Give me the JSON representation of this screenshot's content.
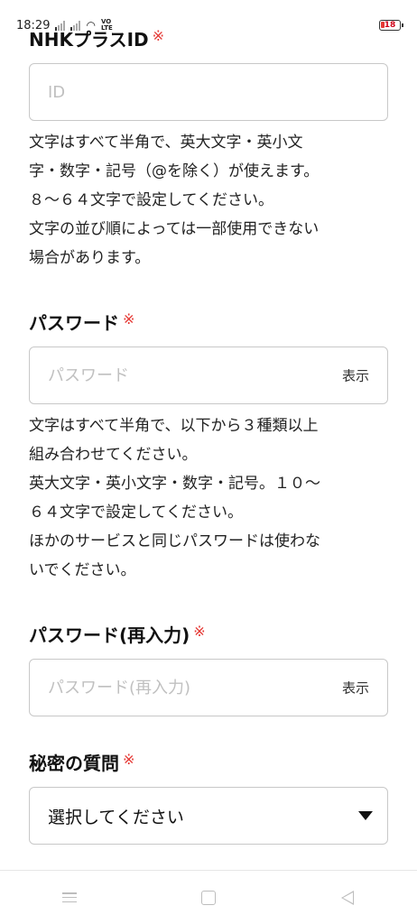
{
  "status_bar": {
    "time": "18:29",
    "volte": "VO\nLTE",
    "battery": "18"
  },
  "fields": {
    "id": {
      "label": "NHKプラスID",
      "required_mark": "※",
      "placeholder": "ID",
      "help": [
        "文字はすべて半角で、英大文字・英小文",
        "字・数字・記号（@を除く）が使えます。",
        "８〜６４文字で設定してください。",
        "文字の並び順によっては一部使用できない",
        "場合があります。"
      ]
    },
    "password": {
      "label": "パスワード",
      "required_mark": "※",
      "placeholder": "パスワード",
      "show_label": "表示",
      "help": [
        "文字はすべて半角で、以下から３種類以上",
        "組み合わせてください。",
        "英大文字・英小文字・数字・記号。１０〜",
        "６４文字で設定してください。",
        "ほかのサービスと同じパスワードは使わな",
        "いでください。"
      ]
    },
    "password_confirm": {
      "label": "パスワード(再入力)",
      "required_mark": "※",
      "placeholder": "パスワード(再入力)",
      "show_label": "表示"
    },
    "secret_question": {
      "label": "秘密の質問",
      "required_mark": "※",
      "selected": "選択してください"
    }
  },
  "icons": {
    "nav_menu": "menu-icon",
    "nav_home": "square-icon",
    "nav_back": "back-triangle-icon"
  }
}
